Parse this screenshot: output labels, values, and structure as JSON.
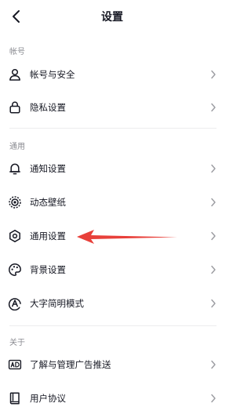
{
  "header": {
    "title": "设置"
  },
  "sections": {
    "account": {
      "label": "帐号",
      "items": [
        {
          "label": "帐号与安全",
          "icon": "user-icon"
        },
        {
          "label": "隐私设置",
          "icon": "lock-icon"
        }
      ]
    },
    "general": {
      "label": "通用",
      "items": [
        {
          "label": "通知设置",
          "icon": "bell-icon"
        },
        {
          "label": "动态壁纸",
          "icon": "live-wallpaper-icon"
        },
        {
          "label": "通用设置",
          "icon": "gear-icon"
        },
        {
          "label": "背景设置",
          "icon": "palette-icon"
        },
        {
          "label": "大字简明模式",
          "icon": "large-text-icon"
        }
      ]
    },
    "about": {
      "label": "关于",
      "items": [
        {
          "label": "了解与管理广告推送",
          "icon": "ad-icon"
        },
        {
          "label": "用户协议",
          "icon": "book-icon"
        }
      ]
    }
  },
  "annotation": {
    "arrow_color": "#e8403a",
    "points_to": "通用设置"
  },
  "colors": {
    "text": "#161823",
    "muted": "#8a8b91",
    "chevron": "#9a9ba0"
  }
}
